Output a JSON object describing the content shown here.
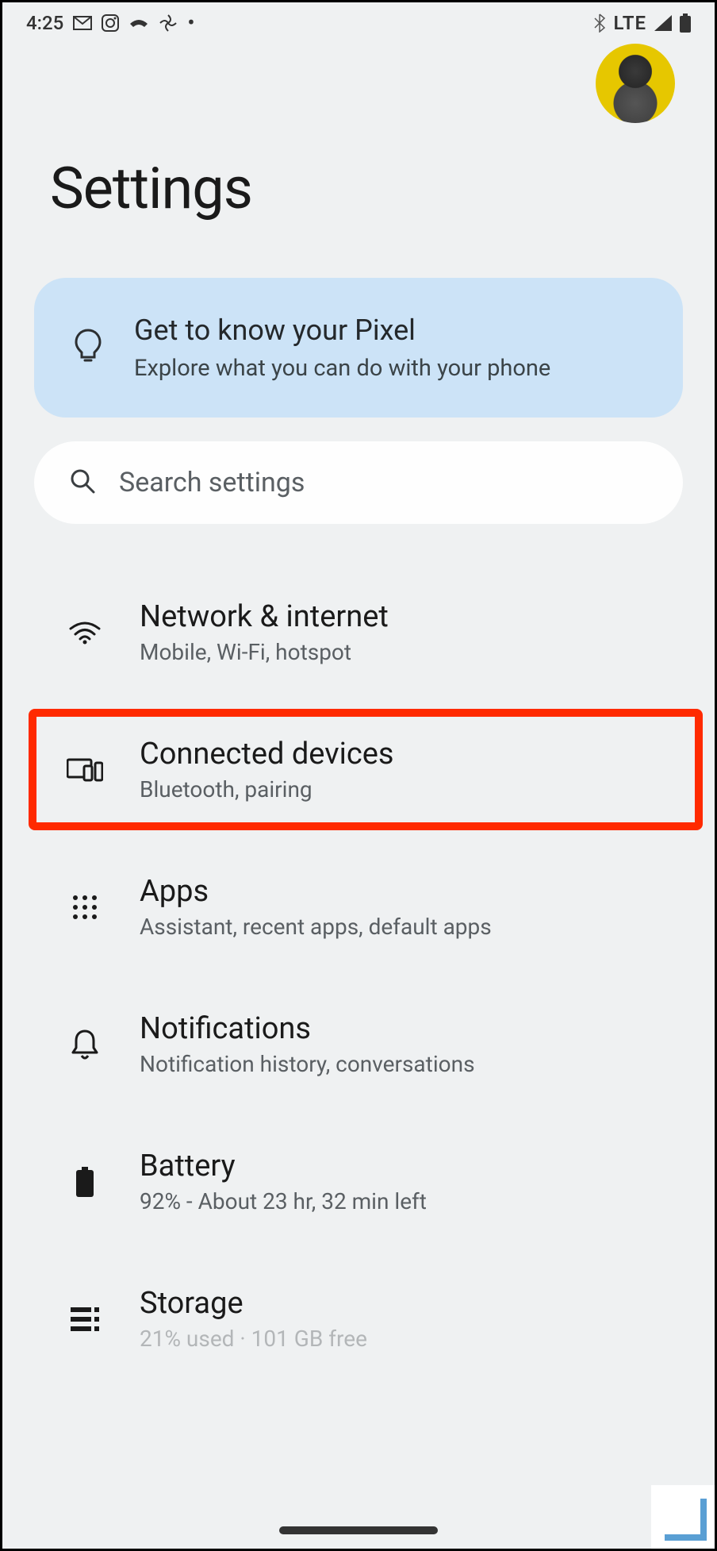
{
  "status_bar": {
    "time": "4:25",
    "network_label": "LTE"
  },
  "page": {
    "title": "Settings"
  },
  "tip_card": {
    "title": "Get to know your Pixel",
    "subtitle": "Explore what you can do with your phone"
  },
  "search": {
    "placeholder": "Search settings"
  },
  "items": [
    {
      "title": "Network & internet",
      "subtitle": "Mobile, Wi-Fi, hotspot",
      "icon": "wifi",
      "highlighted": false
    },
    {
      "title": "Connected devices",
      "subtitle": "Bluetooth, pairing",
      "icon": "devices",
      "highlighted": true
    },
    {
      "title": "Apps",
      "subtitle": "Assistant, recent apps, default apps",
      "icon": "apps",
      "highlighted": false
    },
    {
      "title": "Notifications",
      "subtitle": "Notification history, conversations",
      "icon": "bell",
      "highlighted": false
    },
    {
      "title": "Battery",
      "subtitle": "92% - About 23 hr, 32 min left",
      "icon": "battery",
      "highlighted": false
    },
    {
      "title": "Storage",
      "subtitle": "21% used · 101 GB free",
      "icon": "storage",
      "highlighted": false
    }
  ]
}
